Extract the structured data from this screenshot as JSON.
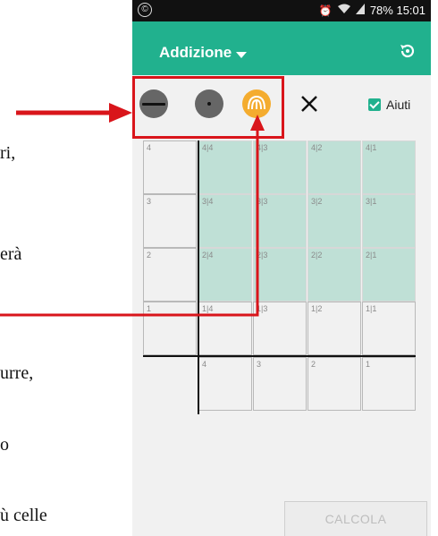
{
  "document_fragments": [
    "ri,",
    "erà",
    "urre,",
    "o",
    "ù celle"
  ],
  "phone": {
    "statusbar": {
      "left_icon": "©",
      "right_text": "78% 15:01",
      "icons": [
        "alarm-icon",
        "wifi-icon",
        "signal-icon"
      ]
    },
    "appbar": {
      "title": "Addizione",
      "color": "#21b18e",
      "dropdown_icon": "caret-down-icon",
      "reset_icon": "reset-icon"
    },
    "toolbar": {
      "tools": [
        {
          "name": "line-tool-icon",
          "style": "dark"
        },
        {
          "name": "dot-tool-icon",
          "style": "dark"
        },
        {
          "name": "shape-tool-icon",
          "style": "orange",
          "selected": true
        },
        {
          "name": "close-tool-icon",
          "style": "plain"
        }
      ],
      "aiuti_label": "Aiuti",
      "aiuti_checked": true
    },
    "grid": {
      "rows": [
        [
          "4",
          "4|4",
          "4|3",
          "4|2",
          "4|1"
        ],
        [
          "3",
          "3|4",
          "3|3",
          "3|2",
          "3|1"
        ],
        [
          "2",
          "2|4",
          "2|3",
          "2|2",
          "2|1"
        ],
        [
          "1",
          "1|4",
          "1|3",
          "1|2",
          "1|1"
        ],
        [
          "",
          "4",
          "3",
          "2",
          "1"
        ]
      ],
      "highlight_color": "#bfe0d6"
    },
    "calcola_label": "CALCOLA"
  },
  "annotation_color": "#d9151b"
}
